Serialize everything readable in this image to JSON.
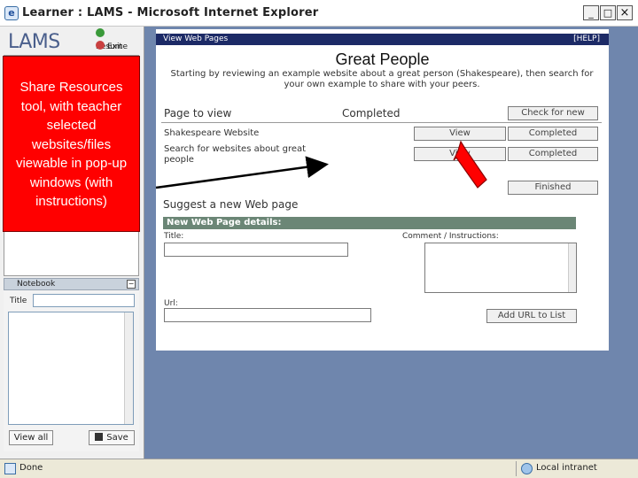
{
  "window": {
    "title": "Learner : LAMS - Microsoft Internet Explorer",
    "minimize_icon": "_",
    "maximize_icon": "□",
    "close_icon": "×"
  },
  "sidebar": {
    "logo": "LAMS",
    "resume_label": "Resume",
    "exit_label": "Exit",
    "notebook": {
      "header": "Notebook",
      "minimize_icon": "−",
      "title_label": "Title",
      "view_all_label": "View all",
      "save_label": "Save"
    }
  },
  "content": {
    "bar_left": "View Web Pages",
    "bar_right": "[HELP]",
    "title": "Great People",
    "intro": "Starting by reviewing an example website about a great person (Shakespeare), then search for your own example to share with your peers.",
    "col_page": "Page to view",
    "col_completed": "Completed",
    "check_button": "Check for new",
    "rows": [
      {
        "name": "Shakespeare Website",
        "view": "View",
        "status": "Completed"
      },
      {
        "name": "Search for websites about great people",
        "view": "View",
        "status": "Completed"
      }
    ],
    "finished_button": "Finished",
    "suggest_title": "Suggest a new Web page",
    "details_header": "New Web Page details:",
    "title_label": "Title:",
    "comment_label": "Comment / Instructions:",
    "url_label": "Url:",
    "add_button": "Add URL to List"
  },
  "status": {
    "left": "Done",
    "zone": "Local intranet"
  },
  "callout": {
    "text": "Share Resources tool, with teacher selected websites/files viewable in pop-up windows (with instructions)",
    "color": "#ff0000"
  }
}
